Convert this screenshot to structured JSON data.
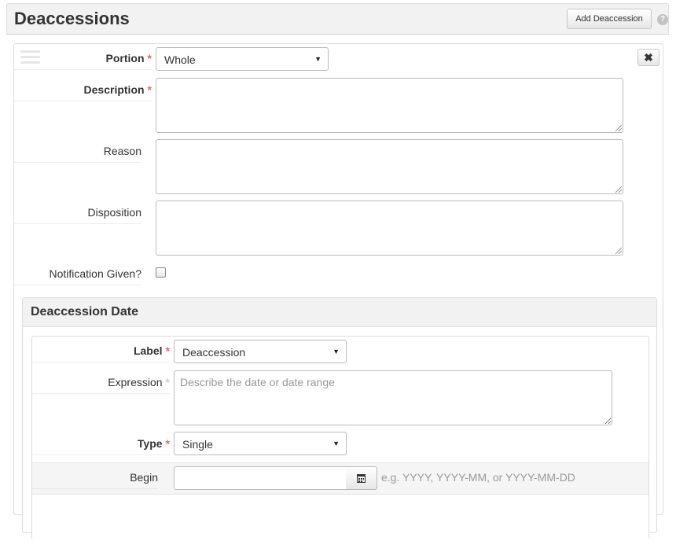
{
  "section": {
    "title": "Deaccessions",
    "add_button": "Add Deaccession",
    "help_icon": "?"
  },
  "record": {
    "remove_icon": "✖",
    "portion": {
      "label": "Portion",
      "required": "*",
      "value": "Whole"
    },
    "description": {
      "label": "Description",
      "required": "*",
      "value": ""
    },
    "reason": {
      "label": "Reason",
      "value": ""
    },
    "disposition": {
      "label": "Disposition",
      "value": ""
    },
    "notification": {
      "label": "Notification Given?",
      "checked": false
    }
  },
  "date_section": {
    "title": "Deaccession Date",
    "label_field": {
      "label": "Label",
      "required": "*",
      "value": "Deaccession"
    },
    "expression": {
      "label": "Expression",
      "required": "*",
      "placeholder": "Describe the date or date range"
    },
    "type_field": {
      "label": "Type",
      "required": "*",
      "value": "Single"
    },
    "begin": {
      "label": "Begin",
      "value": "",
      "hint": "e.g. YYYY, YYYY-MM, or YYYY-MM-DD"
    }
  },
  "colors": {
    "required_star": "#e06a6a",
    "header_bg": "#f2f2f2",
    "border": "#dddddd"
  },
  "icons": [
    "help-icon",
    "remove-icon",
    "drag-handle-icon",
    "caret-down-icon",
    "calendar-icon"
  ]
}
